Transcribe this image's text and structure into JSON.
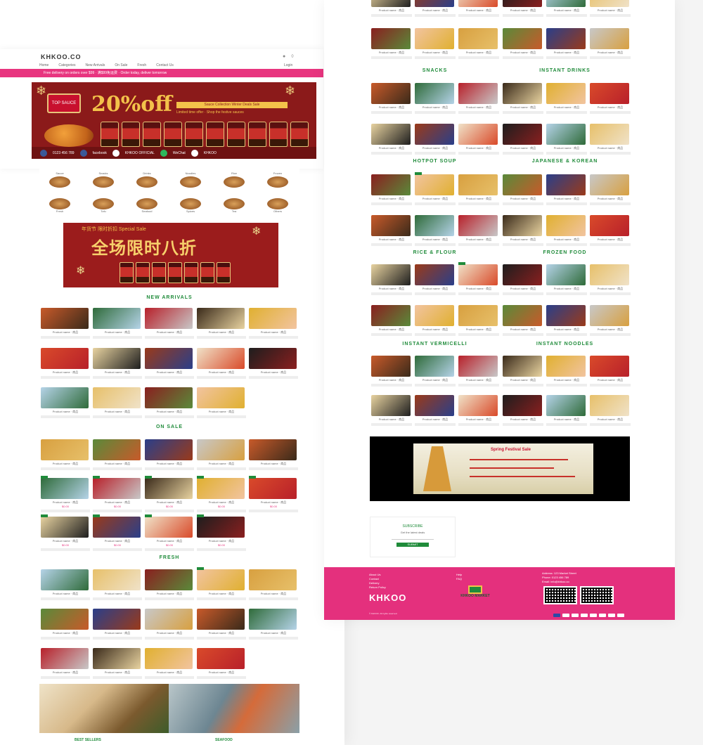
{
  "header": {
    "logo": "KHKOO.CO",
    "icons": [
      "user-icon",
      "cart-icon"
    ],
    "nav": [
      "Home",
      "Categories",
      "New Arrivals",
      "On Sale",
      "Fresh",
      "Contact Us"
    ],
    "login": "Login",
    "announcement": "Free delivery on orders over $99 · 满$99免运费 · Order today, deliver tomorrow"
  },
  "banner1": {
    "brand": "TOP SAUCE",
    "headline": "20%off",
    "tag": "Sauce Collection Winter Deals Sale",
    "sub": "Limited time offer · Shop the festive sauces",
    "contacts": [
      "0123 456 789",
      "facebook",
      "KHKOO OFFICIAL",
      "WeChat",
      "KHKOO"
    ]
  },
  "categories": {
    "row1": [
      "Sauce",
      "Snacks",
      "Drinks",
      "Noodles",
      "Rice",
      "Frozen"
    ],
    "row2": [
      "Fresh",
      "Tofu",
      "Seafood",
      "Spices",
      "Tea",
      "Others"
    ]
  },
  "banner2": {
    "top": "年货节 限时折扣 Special Sale",
    "headline": "全场限时八折"
  },
  "sections": {
    "new_arrivals": "NEW ARRIVALS",
    "on_sale": "ON SALE",
    "fresh": "FRESH",
    "snacks": "SNACKS",
    "instant_drinks": "INSTANT DRINKS",
    "hotpot": "HOTPOT SOUP",
    "japanese_korean": "JAPANESE & KOREAN",
    "rice_flour": "RICE & FLOUR",
    "frozen": "FROZEN FOOD",
    "instant_vermicelli": "INSTANT VERMICELLI",
    "instant_noodles": "INSTANT NOODLES",
    "bottom_left": "BEST SELLERS",
    "bottom_right": "SEAFOOD"
  },
  "product": {
    "name": "Product name · 商品",
    "price": "$0.00"
  },
  "promo": {
    "title": "Spring Festival Sale"
  },
  "newsletter": {
    "title": "SUBSCRIBE",
    "subtitle": "Get the latest deals",
    "button": "SUBMIT"
  },
  "footer": {
    "col1": [
      "About Us",
      "Contact",
      "Delivery",
      "Return Policy"
    ],
    "col2": [
      "Help",
      "FAQ"
    ],
    "col3": [
      "Address: 123 Market Street",
      "Phone: 0123 456 789",
      "Email: info@khkoo.co"
    ],
    "brand1": "KHKOO",
    "brand2": "KHKOO MARKET",
    "copyright": "© KHKOO. All rights reserved."
  },
  "colors": {
    "brand_pink": "#e4307d",
    "green": "#1f8b3a",
    "banner_red": "#8b1a1a"
  }
}
